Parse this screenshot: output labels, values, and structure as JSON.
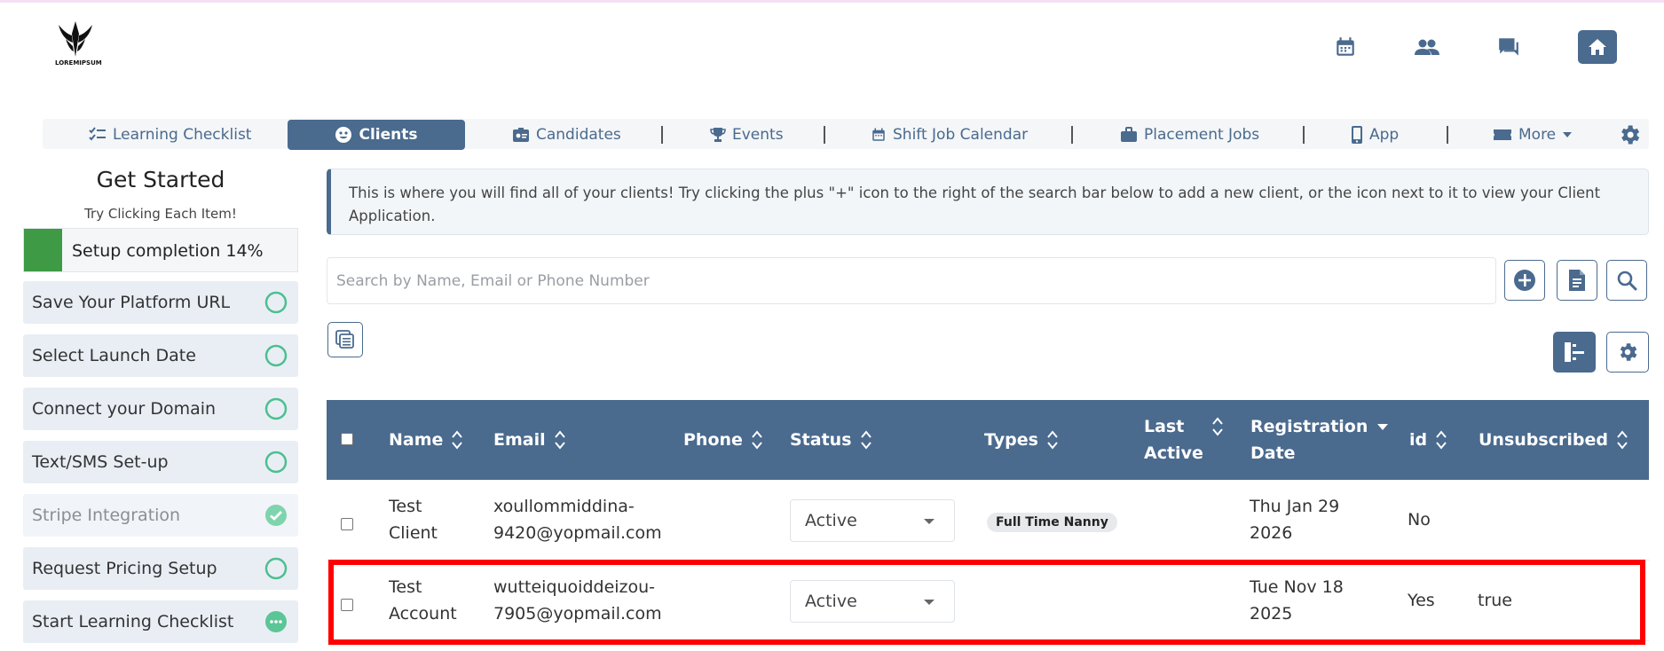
{
  "header": {
    "logo_text": "LOREMIPSUM",
    "icons": [
      "calendar-icon",
      "people-icon",
      "chat-icon",
      "home-icon"
    ]
  },
  "nav": {
    "tabs": [
      {
        "label": "Learning Checklist",
        "icon": "checklist-icon",
        "active": false
      },
      {
        "label": "Clients",
        "icon": "smile-icon",
        "active": true
      },
      {
        "label": "Candidates",
        "icon": "id-badge-icon",
        "active": false
      },
      {
        "label": "Events",
        "icon": "trophy-icon",
        "active": false
      },
      {
        "label": "Shift Job Calendar",
        "icon": "calendar-icon",
        "active": false
      },
      {
        "label": "Placement Jobs",
        "icon": "briefcase-icon",
        "active": false
      },
      {
        "label": "App",
        "icon": "phone-icon",
        "active": false
      },
      {
        "label": "More",
        "icon": "ticket-icon",
        "active": false
      }
    ]
  },
  "sidebar": {
    "title": "Get Started",
    "subtitle": "Try Clicking Each Item!",
    "progress_label": "Setup completion 14%",
    "progress_value": 0.14,
    "steps": [
      {
        "label": "Save Your Platform URL",
        "state": "pending"
      },
      {
        "label": "Select Launch Date",
        "state": "pending"
      },
      {
        "label": "Connect your Domain",
        "state": "pending"
      },
      {
        "label": "Text/SMS Set-up",
        "state": "pending"
      },
      {
        "label": "Stripe Integration",
        "state": "done"
      },
      {
        "label": "Request Pricing Setup",
        "state": "pending"
      },
      {
        "label": "Start Learning Checklist",
        "state": "in-progress"
      }
    ]
  },
  "info": {
    "text": "This is where you will find all of your clients! Try clicking the plus \"+\" icon to the right of the search bar below to add a new client, or the icon next to it to view your Client Application."
  },
  "search": {
    "placeholder": "Search by Name, Email or Phone Number"
  },
  "table": {
    "headers": {
      "name": "Name",
      "email": "Email",
      "phone": "Phone",
      "status": "Status",
      "types": "Types",
      "last_active_1": "Last",
      "last_active_2": "Active",
      "reg_1": "Registration",
      "reg_2": "Date",
      "id": "id",
      "unsubscribed": "Unsubscribed"
    },
    "rows": [
      {
        "name_1": "Test",
        "name_2": "Client",
        "email_1": "xoullommiddina-",
        "email_2": "9420@yopmail.com",
        "phone": "",
        "status": "Active",
        "type": "Full Time Nanny",
        "date_1": "Thu Jan 29",
        "date_2": "2026",
        "id": "No",
        "unsubscribed": ""
      },
      {
        "name_1": "Test",
        "name_2": "Account",
        "email_1": "wutteiquoiddeizou-",
        "email_2": "7905@yopmail.com",
        "phone": "",
        "status": "Active",
        "type": "",
        "date_1": "Tue Nov 18",
        "date_2": "2025",
        "id": "Yes",
        "unsubscribed": "true"
      }
    ]
  },
  "colors": {
    "primary": "#4a6a8e",
    "progress": "#3e9a44",
    "check": "#4dbf8f",
    "highlight": "#ff0000"
  }
}
